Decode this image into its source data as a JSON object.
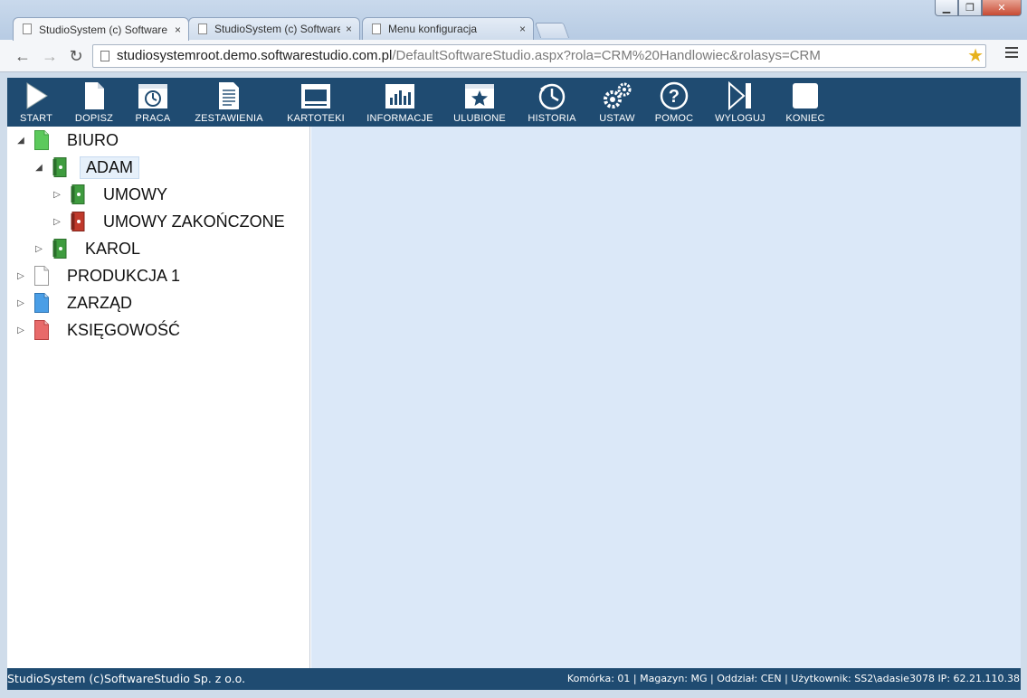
{
  "browser": {
    "tabs": [
      {
        "title": "StudioSystem (c) Software",
        "active": true
      },
      {
        "title": "StudioSystem (c) Software",
        "active": false
      },
      {
        "title": "Menu konfiguracja",
        "active": false
      }
    ],
    "tab_close": "×",
    "url_host": "studiosystemroot.demo.softwarestudio.com.pl",
    "url_path": "/DefaultSoftwareStudio.aspx?rola=CRM%20Handlowiec&rolasys=CRM"
  },
  "toolbar": {
    "items": [
      {
        "label": "START",
        "icon": "play-icon"
      },
      {
        "label": "DOPISZ",
        "icon": "new-document-icon"
      },
      {
        "label": "PRACA",
        "icon": "clock-window-icon"
      },
      {
        "label": "ZESTAWIENIA",
        "icon": "report-icon"
      },
      {
        "label": "KARTOTEKI",
        "icon": "window-icon"
      },
      {
        "label": "INFORMACJE",
        "icon": "chart-icon"
      },
      {
        "label": "ULUBIONE",
        "icon": "star-window-icon"
      },
      {
        "label": "HISTORIA",
        "icon": "history-icon"
      },
      {
        "label": "USTAW",
        "icon": "gears-icon"
      },
      {
        "label": "POMOC",
        "icon": "help-icon"
      },
      {
        "label": "WYLOGUJ",
        "icon": "logout-icon"
      },
      {
        "label": "KONIEC",
        "icon": "end-icon"
      }
    ]
  },
  "tree": {
    "nodes": [
      {
        "label": "BIURO",
        "expanded": true,
        "icon": "green-document-icon",
        "level": 0
      },
      {
        "label": "ADAM",
        "expanded": true,
        "icon": "green-binder-icon",
        "level": 1,
        "selected": true
      },
      {
        "label": "UMOWY",
        "expanded": false,
        "icon": "green-binder-icon",
        "level": 2
      },
      {
        "label": "UMOWY ZAKOŃCZONE",
        "expanded": false,
        "icon": "red-binder-icon",
        "level": 2
      },
      {
        "label": "KAROL",
        "expanded": false,
        "icon": "green-binder-icon",
        "level": 1
      },
      {
        "label": "PRODUKCJA 1",
        "expanded": false,
        "icon": "white-document-icon",
        "level": 0
      },
      {
        "label": "ZARZĄD",
        "expanded": false,
        "icon": "blue-document-icon",
        "level": 0
      },
      {
        "label": "KSIĘGOWOŚĆ",
        "expanded": false,
        "icon": "red-document-icon",
        "level": 0
      }
    ]
  },
  "status": {
    "left": "StudioSystem (c)SoftwareStudio Sp. z o.o.",
    "right": "Komórka: 01 | Magazyn: MG | Oddział: CEN | Użytkownik: SS2\\adasie3078 IP: 62.21.110.38"
  },
  "colors": {
    "toolbar_bg": "#1f4b71",
    "content_bg": "#dbe8f8",
    "green_doc": "#5cc95c",
    "red_doc": "#e86a6a",
    "blue_doc": "#4a9ee6"
  }
}
